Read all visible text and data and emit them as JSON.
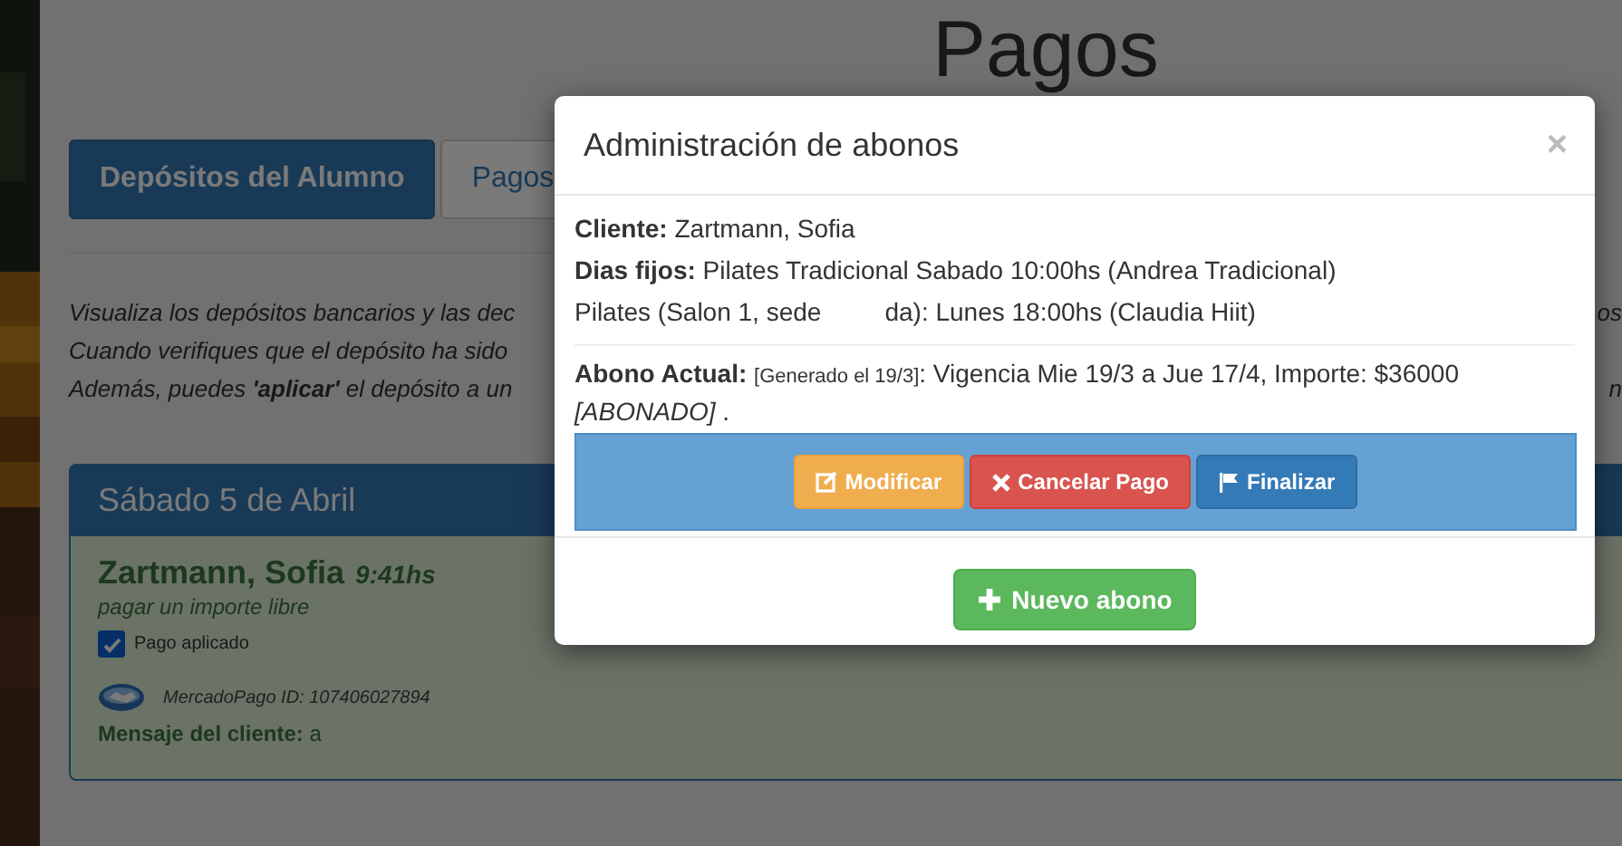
{
  "page": {
    "title": "Pagos"
  },
  "tabs": [
    {
      "label": "Depósitos del Alumno",
      "selected": true
    },
    {
      "label": "Pagos",
      "selected": false
    }
  ],
  "intro_lines": [
    {
      "text": "Visualiza los depósitos bancarios y las dec",
      "right": "os"
    },
    {
      "text": "Cuando verifiques que el depósito ha sido"
    },
    {
      "text": "Además, puedes **'aplicar'** el depósito a un",
      "right": "n"
    }
  ],
  "deposit_card": {
    "date": "Sábado 5 de Abril",
    "client": "Zartmann, Sofia",
    "time": "9:41hs",
    "concept": "pagar un importe libre",
    "applied": {
      "label": "Pago aplicado",
      "checked": true
    },
    "payment_id": "MercadoPago ID: 107406027894",
    "message": "**Mensaje del cliente:** a"
  },
  "modal": {
    "title": "Administración de abonos",
    "close": "×",
    "client": "**Cliente:** Zartmann, Sofia",
    "fixed_days": "**Dias fijos:** Pilates Tradicional   Sabado 10:00hs (Andrea Tradicional)",
    "fixed_days_2": [
      "Pilates (Salon 1, sede",
      "da): Lunes 18:00hs (Claudia Hiit)"
    ],
    "current": {
      "label": "Abono Actual:",
      "generated": "[Generado el 19/3]",
      "text": ": Vigencia Mie 19/3 a Jue 17/4, Importe: $36000",
      "status": "[ABONADO]",
      "end": " ."
    },
    "actions": [
      {
        "kind": "edit",
        "label": "Modificar"
      },
      {
        "kind": "cancel",
        "label": "Cancelar Pago"
      },
      {
        "kind": "finish",
        "label": "Finalizar"
      }
    ],
    "new_button": "Nuevo abono"
  }
}
